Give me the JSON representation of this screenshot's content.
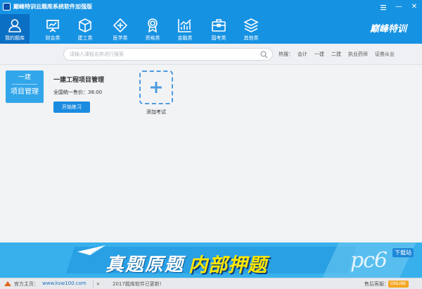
{
  "window": {
    "title": "巅峰特训云题库系统软件加强版",
    "menu_icon": "menu-icon",
    "minimize": "—",
    "close": "✕"
  },
  "nav": {
    "items": [
      {
        "label": "我的题库",
        "icon": "user-icon",
        "active": true
      },
      {
        "label": "财会类",
        "icon": "presentation-board-icon"
      },
      {
        "label": "建工类",
        "icon": "cube-icon"
      },
      {
        "label": "医学类",
        "icon": "medical-cross-icon"
      },
      {
        "label": "资格类",
        "icon": "award-badge-icon"
      },
      {
        "label": "金融类",
        "icon": "bar-chart-icon"
      },
      {
        "label": "国考类",
        "icon": "briefcase-icon"
      },
      {
        "label": "其他类",
        "icon": "layers-icon"
      }
    ],
    "brand": "巅峰特训",
    "accent": "#1692e3"
  },
  "search": {
    "placeholder": "请输入课程名称进行搜索",
    "hot_label": "热搜：",
    "hot_links": [
      "会计",
      "一建",
      "二建",
      "执业药师",
      "证券从业"
    ]
  },
  "main": {
    "exam_card": {
      "line1": "一建",
      "line2": "项目管理"
    },
    "exam_title": "一建工程项目管理",
    "exam_price": "全国统一售价：38.00",
    "start_button": "开始练习",
    "add_exam_label": "添加考试"
  },
  "banner": {
    "text_white": "真题原题",
    "text_yellow": "内部押题",
    "watermark": "pc6",
    "watermark_badge": "下载站"
  },
  "footer": {
    "home_label": "官方主页：",
    "home_link": "www.ksw100.com",
    "news_icon": "»",
    "news": "2017题库软件已更新!",
    "service_label": "售后客服：",
    "online_badge": "ONLINE"
  }
}
